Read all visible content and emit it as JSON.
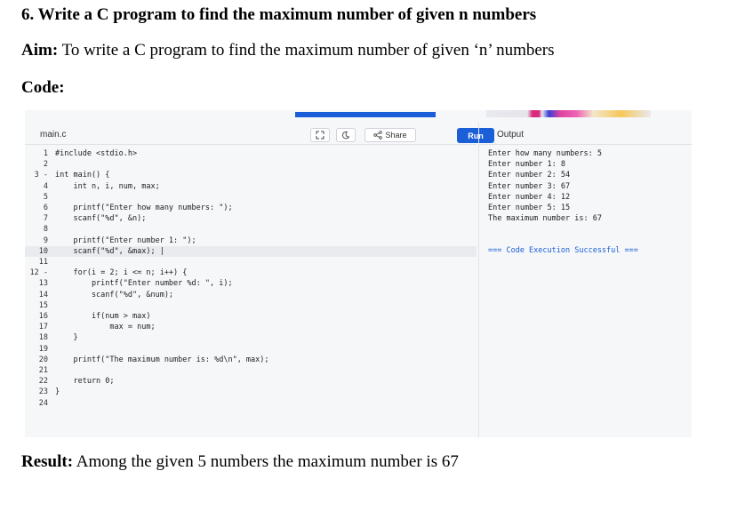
{
  "heading": "6.  Write a C program to find the maximum number of given n numbers",
  "aim": {
    "label": "Aim:",
    "text": " To write a C program to find the maximum number of given ‘n’ numbers"
  },
  "code_label": "Code:",
  "result": {
    "label": "Result:",
    "text": " Among the given 5 numbers the maximum number is 67"
  },
  "editor": {
    "file_tab": "main.c",
    "share_label": "Share",
    "run_label": "Run",
    "lines": [
      {
        "n": "1",
        "code": "#include <stdio.h>"
      },
      {
        "n": "2",
        "code": ""
      },
      {
        "n": "3 -",
        "code": "int main() {"
      },
      {
        "n": "4",
        "code": "    int n, i, num, max;"
      },
      {
        "n": "5",
        "code": ""
      },
      {
        "n": "6",
        "code": "    printf(\"Enter how many numbers: \");"
      },
      {
        "n": "7",
        "code": "    scanf(\"%d\", &n);"
      },
      {
        "n": "8",
        "code": ""
      },
      {
        "n": "9",
        "code": "    printf(\"Enter number 1: \");"
      },
      {
        "n": "10",
        "code": "    scanf(\"%d\", &max); |"
      },
      {
        "n": "11",
        "code": ""
      },
      {
        "n": "12 -",
        "code": "    for(i = 2; i <= n; i++) {"
      },
      {
        "n": "13",
        "code": "        printf(\"Enter number %d: \", i);"
      },
      {
        "n": "14",
        "code": "        scanf(\"%d\", &num);"
      },
      {
        "n": "15",
        "code": ""
      },
      {
        "n": "16",
        "code": "        if(num > max)"
      },
      {
        "n": "17",
        "code": "            max = num;"
      },
      {
        "n": "18",
        "code": "    }"
      },
      {
        "n": "19",
        "code": ""
      },
      {
        "n": "20",
        "code": "    printf(\"The maximum number is: %d\\n\", max);"
      },
      {
        "n": "21",
        "code": ""
      },
      {
        "n": "22",
        "code": "    return 0;"
      },
      {
        "n": "23",
        "code": "}"
      },
      {
        "n": "24",
        "code": ""
      }
    ]
  },
  "output": {
    "title": "Output",
    "lines": [
      "Enter how many numbers: 5",
      "Enter number 1: 8",
      "Enter number 2: 54",
      "Enter number 3: 67",
      "Enter number 4: 12",
      "Enter number 5: 15",
      "The maximum number is: 67"
    ],
    "success": "=== Code Execution Successful ==="
  },
  "colors": {
    "accent": "#1a5fd8"
  }
}
